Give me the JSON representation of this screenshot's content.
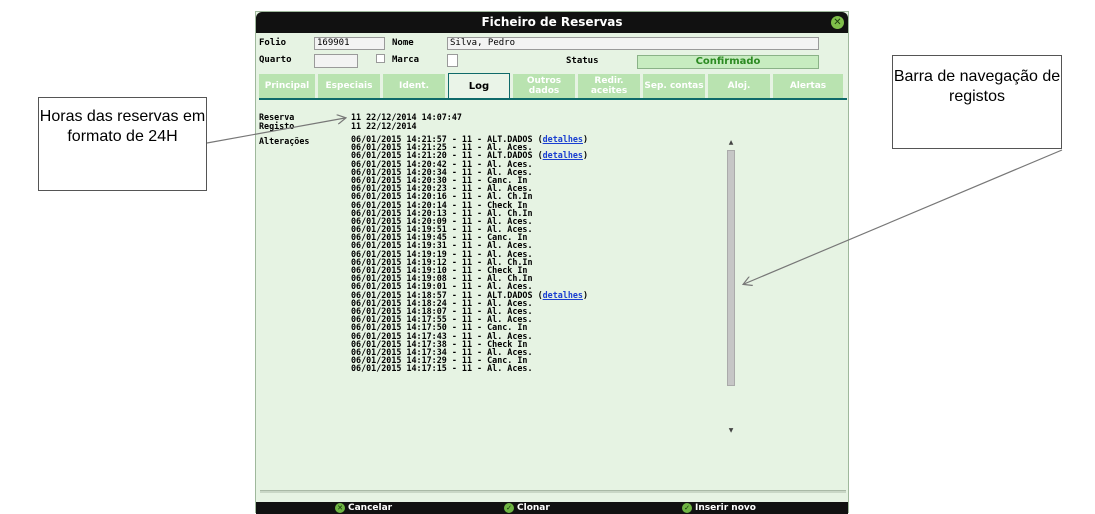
{
  "window": {
    "title": "Ficheiro de Reservas",
    "close_icon": "close-icon"
  },
  "header": {
    "folio_label": "Folio",
    "folio_value": "169901",
    "nome_label": "Nome",
    "nome_value": "Silva, Pedro",
    "quarto_label": "Quarto",
    "quarto_value": "",
    "marca_label": "Marca",
    "status_label": "Status",
    "status_value": "Confirmado"
  },
  "tabs": [
    {
      "label": "Principal"
    },
    {
      "label": "Especiais"
    },
    {
      "label": "Ident."
    },
    {
      "label": "Log"
    },
    {
      "label": "Outros dados"
    },
    {
      "label": "Redir. aceites"
    },
    {
      "label": "Sep. contas"
    },
    {
      "label": "Aloj."
    },
    {
      "label": "Alertas"
    }
  ],
  "active_tab": "Log",
  "log": {
    "reserva_label": "Reserva",
    "reserva_value": "11 22/12/2014 14:07:47",
    "registo_label": "Registo",
    "registo_value": "11 22/12/2014",
    "alteracoes_label": "Alterações",
    "details_link": "detalhes",
    "entries": [
      {
        "text": "06/01/2015 14:21:57 - 11 - ALT.DADOS",
        "link": true
      },
      {
        "text": "06/01/2015 14:21:25 - 11 - Al. Aces."
      },
      {
        "text": "06/01/2015 14:21:20 - 11 - ALT.DADOS",
        "link": true
      },
      {
        "text": "06/01/2015 14:20:42 - 11 - Al. Aces."
      },
      {
        "text": "06/01/2015 14:20:34 - 11 - Al. Aces."
      },
      {
        "text": "06/01/2015 14:20:30 - 11 - Canc. In"
      },
      {
        "text": "06/01/2015 14:20:23 - 11 - Al. Aces."
      },
      {
        "text": "06/01/2015 14:20:16 - 11 - Al. Ch.In"
      },
      {
        "text": "06/01/2015 14:20:14 - 11 - Check In"
      },
      {
        "text": "06/01/2015 14:20:13 - 11 - Al. Ch.In"
      },
      {
        "text": "06/01/2015 14:20:09 - 11 - Al. Aces."
      },
      {
        "text": "06/01/2015 14:19:51 - 11 - Al. Aces."
      },
      {
        "text": "06/01/2015 14:19:45 - 11 - Canc. In"
      },
      {
        "text": "06/01/2015 14:19:31 - 11 - Al. Aces."
      },
      {
        "text": "06/01/2015 14:19:19 - 11 - Al. Aces."
      },
      {
        "text": "06/01/2015 14:19:12 - 11 - Al. Ch.In"
      },
      {
        "text": "06/01/2015 14:19:10 - 11 - Check In"
      },
      {
        "text": "06/01/2015 14:19:08 - 11 - Al. Ch.In"
      },
      {
        "text": "06/01/2015 14:19:01 - 11 - Al. Aces."
      },
      {
        "text": "06/01/2015 14:18:57 - 11 - ALT.DADOS",
        "link": true
      },
      {
        "text": "06/01/2015 14:18:24 - 11 - Al. Aces."
      },
      {
        "text": "06/01/2015 14:18:07 - 11 - Al. Aces."
      },
      {
        "text": "06/01/2015 14:17:55 - 11 - Al. Aces."
      },
      {
        "text": "06/01/2015 14:17:50 - 11 - Canc. In"
      },
      {
        "text": "06/01/2015 14:17:43 - 11 - Al. Aces."
      },
      {
        "text": "06/01/2015 14:17:38 - 11 - Check In"
      },
      {
        "text": "06/01/2015 14:17:34 - 11 - Al. Aces."
      },
      {
        "text": "06/01/2015 14:17:29 - 11 - Canc. In"
      },
      {
        "text": "06/01/2015 14:17:15 - 11 - Al. Aces."
      }
    ]
  },
  "footer": {
    "cancel_label": "Cancelar",
    "clone_label": "Clonar",
    "insert_label": "Inserir novo"
  },
  "annotations": {
    "left_callout": "Horas das reservas em formato de 24H",
    "right_callout": "Barra de navegação de registos"
  },
  "colors": {
    "titlebar": "#111111",
    "panel": "#e6f3e3",
    "tab_inactive": "#b9e3b0",
    "status_text": "#2c8a22",
    "link": "#1a3fd1"
  }
}
